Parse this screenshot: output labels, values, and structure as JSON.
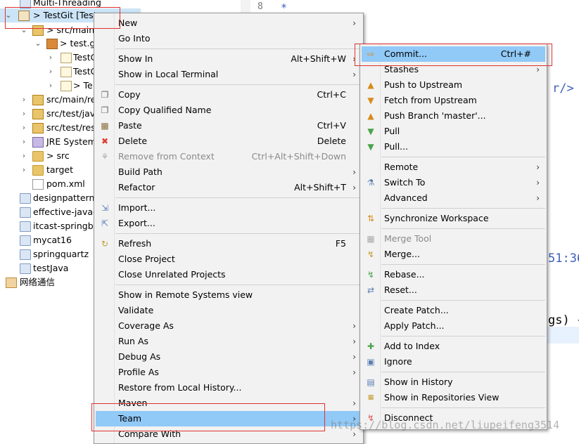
{
  "explorer": {
    "items": [
      {
        "label": "Multi-Threading"
      },
      {
        "label": "> TestGit [Test"
      },
      {
        "label": "> src/main/"
      },
      {
        "label": "> test.gi"
      },
      {
        "label": "TestG"
      },
      {
        "label": "TestG"
      },
      {
        "label": "> Te"
      },
      {
        "label": "src/main/re"
      },
      {
        "label": "src/test/java"
      },
      {
        "label": "src/test/res"
      },
      {
        "label": "JRE System"
      },
      {
        "label": "> src"
      },
      {
        "label": "target"
      },
      {
        "label": "pom.xml"
      },
      {
        "label": "designpattern"
      },
      {
        "label": "effective-java-e"
      },
      {
        "label": "itcast-springbo"
      },
      {
        "label": "mycat16"
      },
      {
        "label": "springquartz"
      },
      {
        "label": "testJava"
      },
      {
        "label": "网络通信"
      }
    ]
  },
  "editor": {
    "line_number": "8",
    "comment_star": "*",
    "fragment_tag": "r/>",
    "fragment_time": "51:36",
    "fragment_args": "gs) {"
  },
  "main_menu": {
    "items": [
      {
        "label": "New"
      },
      {
        "label": "Go Into"
      },
      {
        "label": "Show In",
        "shortcut": "Alt+Shift+W"
      },
      {
        "label": "Show in Local Terminal"
      },
      {
        "label": "Copy",
        "shortcut": "Ctrl+C"
      },
      {
        "label": "Copy Qualified Name"
      },
      {
        "label": "Paste",
        "shortcut": "Ctrl+V"
      },
      {
        "label": "Delete",
        "shortcut": "Delete"
      },
      {
        "label": "Remove from Context",
        "shortcut": "Ctrl+Alt+Shift+Down"
      },
      {
        "label": "Build Path"
      },
      {
        "label": "Refactor",
        "shortcut": "Alt+Shift+T"
      },
      {
        "label": "Import..."
      },
      {
        "label": "Export..."
      },
      {
        "label": "Refresh",
        "shortcut": "F5"
      },
      {
        "label": "Close Project"
      },
      {
        "label": "Close Unrelated Projects"
      },
      {
        "label": "Show in Remote Systems view"
      },
      {
        "label": "Validate"
      },
      {
        "label": "Coverage As"
      },
      {
        "label": "Run As"
      },
      {
        "label": "Debug As"
      },
      {
        "label": "Profile As"
      },
      {
        "label": "Restore from Local History..."
      },
      {
        "label": "Maven"
      },
      {
        "label": "Team"
      },
      {
        "label": "Compare With"
      }
    ]
  },
  "team_menu": {
    "items": [
      {
        "label": "Commit...",
        "shortcut": "Ctrl+#"
      },
      {
        "label": "Stashes"
      },
      {
        "label": "Push to Upstream"
      },
      {
        "label": "Fetch from Upstream"
      },
      {
        "label": "Push Branch 'master'..."
      },
      {
        "label": "Pull"
      },
      {
        "label": "Pull..."
      },
      {
        "label": "Remote"
      },
      {
        "label": "Switch To"
      },
      {
        "label": "Advanced"
      },
      {
        "label": "Synchronize Workspace"
      },
      {
        "label": "Merge Tool"
      },
      {
        "label": "Merge..."
      },
      {
        "label": "Rebase..."
      },
      {
        "label": "Reset..."
      },
      {
        "label": "Create Patch..."
      },
      {
        "label": "Apply Patch..."
      },
      {
        "label": "Add to Index"
      },
      {
        "label": "Ignore"
      },
      {
        "label": "Show in History"
      },
      {
        "label": "Show in Repositories View"
      },
      {
        "label": "Disconnect"
      }
    ]
  },
  "watermark": "https://blog.csdn.net/liupeifeng3514",
  "colors": {
    "highlight": "#91c9f7",
    "annotation_red": "#e03030",
    "menu_bg": "#f2f2f2"
  }
}
